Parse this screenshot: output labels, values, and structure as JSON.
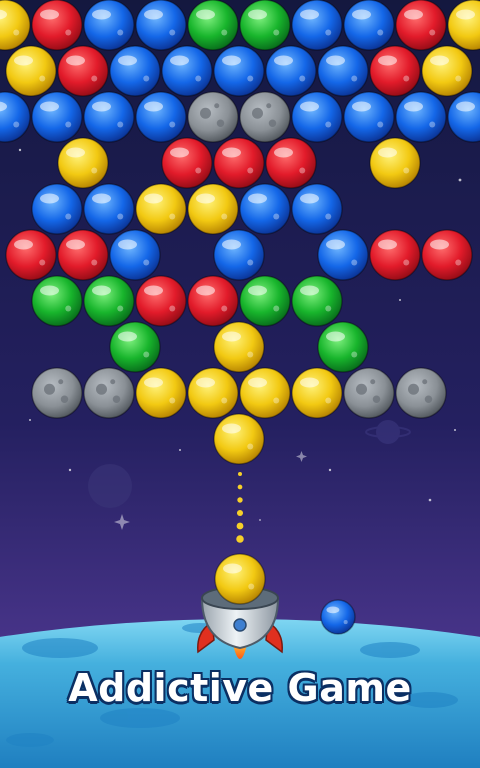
{
  "screen": {
    "caption": "Addictive Game"
  },
  "palette": {
    "red": "#e21b2a",
    "blue": "#1467e8",
    "yellow": "#f2c912",
    "green": "#18b52c",
    "rock": "#8a9096",
    "sky_top": "#16184a",
    "sky_bottom": "#5a3e9c",
    "ground": "#3aa8d6"
  },
  "board": {
    "rows": [
      [
        "yellow",
        "red",
        "blue",
        "blue",
        "green",
        "green",
        "blue",
        "blue",
        "red",
        "yellow"
      ],
      [
        "yellow",
        "red",
        "blue",
        "blue",
        "blue",
        "blue",
        "blue",
        "red",
        "yellow"
      ],
      [
        "blue",
        "blue",
        "blue",
        "blue",
        "rock",
        "rock",
        "blue",
        "blue",
        "blue",
        "blue"
      ],
      [
        null,
        "yellow",
        null,
        "red",
        "red",
        "red",
        null,
        "yellow",
        null
      ],
      [
        null,
        "blue",
        "blue",
        "yellow",
        "yellow",
        "blue",
        "blue",
        null,
        null,
        null
      ],
      [
        "red",
        "red",
        "blue",
        null,
        "blue",
        null,
        "blue",
        "red",
        "red"
      ],
      [
        null,
        "green",
        "green",
        "red",
        "red",
        "green",
        "green",
        null,
        null,
        null
      ],
      [
        null,
        null,
        "green",
        null,
        "yellow",
        null,
        "green",
        null,
        null
      ],
      [
        null,
        "rock",
        "rock",
        "yellow",
        "yellow",
        "yellow",
        "yellow",
        "rock",
        "rock",
        null
      ],
      [
        null,
        null,
        null,
        null,
        "yellow",
        null,
        null,
        null,
        null
      ]
    ]
  },
  "shooter": {
    "loaded_bubble": "yellow",
    "next_bubble": "blue",
    "aim_dots": 6
  }
}
